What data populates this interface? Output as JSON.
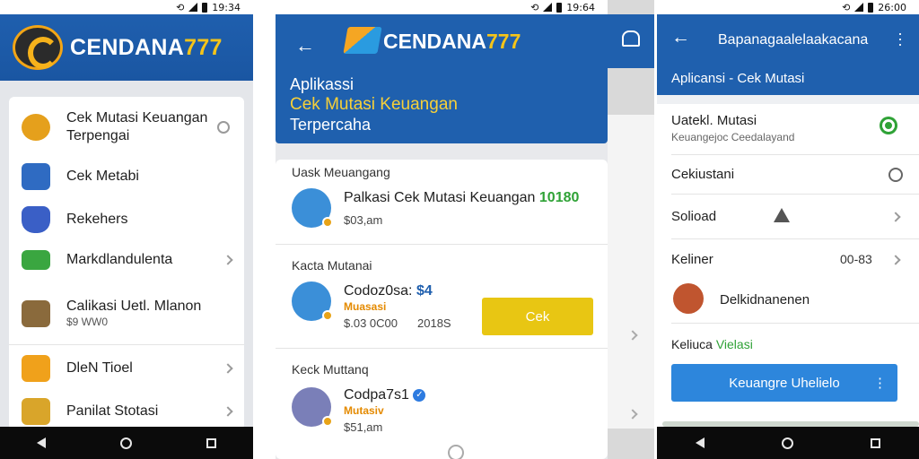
{
  "status_bar": {
    "time_1": "19:34",
    "time_2": "19:64",
    "time_3": "26:00"
  },
  "phone1": {
    "brand": {
      "main": "CENDANA",
      "accent": "777"
    },
    "menu": [
      {
        "title": "Cek Mutasi Keuangan",
        "title2": "Terpengai",
        "icon": "coins-icon",
        "color": "#e5a01c"
      },
      {
        "title": "Cek Metabi",
        "icon": "chart-icon",
        "color": "#2f6bc2"
      },
      {
        "title": "Rekehers",
        "icon": "cube-icon",
        "color": "#3a5fc6"
      },
      {
        "title": "Markdlandulenta",
        "icon": "wallet-icon",
        "color": "#3aa640"
      },
      {
        "title": "Calikasi Uetl. Mlanon",
        "subtitle": "$9 WW0",
        "icon": "bag-icon",
        "color": "#8a6a3c"
      },
      {
        "title": "DleN Tioel",
        "icon": "receipt-icon",
        "color": "#f0a11b"
      },
      {
        "title": "Panilat Stotasi",
        "icon": "money-icon",
        "color": "#d9a52a"
      }
    ]
  },
  "phone2": {
    "brand": {
      "main": "CENDANA",
      "accent": "777"
    },
    "heading": {
      "line1": "Aplikassi",
      "line2": "Cek Mutasi Keuangan",
      "line3": "Terpercaha"
    },
    "sections": [
      {
        "label": "Uask Meuangang",
        "title": "Palkasi Cek Mutasi Keuangan",
        "title_accent": "10180",
        "amount": "$03,am"
      },
      {
        "label": "Kacta Mutanai",
        "title": "Codoz0sa:",
        "title_accent": "$4",
        "tag": "Muasasi",
        "amount": "$.03 0C00",
        "amount2": "2018S"
      },
      {
        "label": "Keck Muttanq",
        "title": "Codpa7s1",
        "tag": "Mutasiv",
        "amount": "$51,am"
      }
    ],
    "cek_button": "Cek"
  },
  "phone3": {
    "title": "Bapanagaalelaakacana",
    "subtitle": "Aplicansi - Cek Mutasi",
    "rows": [
      {
        "title": "Uatekl. Mutasi",
        "subtitle": "Keuangejoc Ceedalayand"
      },
      {
        "title": "Cekiustani"
      },
      {
        "title": "Solioad"
      },
      {
        "title": "Keliner",
        "value": "00-83"
      },
      {
        "title": "Delkidnanenen"
      }
    ],
    "section_label": "Keliuca",
    "section_accent": "Vielasi",
    "button": "Keuangre Uhelielo"
  }
}
